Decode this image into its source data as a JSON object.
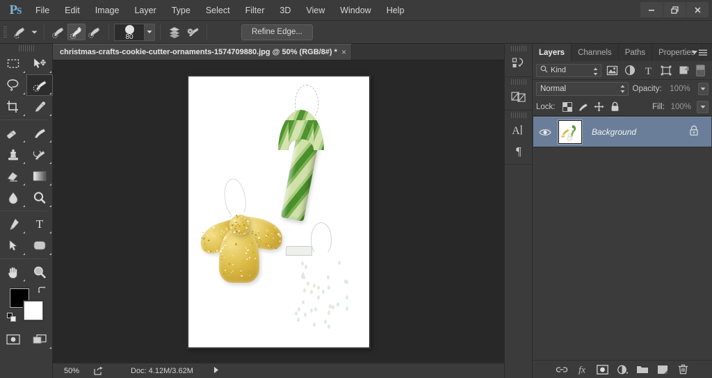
{
  "app": {
    "name": "Ps",
    "logo_text_p": "P",
    "logo_text_s": "s"
  },
  "menubar": {
    "items": [
      {
        "label": "File"
      },
      {
        "label": "Edit"
      },
      {
        "label": "Image"
      },
      {
        "label": "Layer"
      },
      {
        "label": "Type"
      },
      {
        "label": "Select"
      },
      {
        "label": "Filter"
      },
      {
        "label": "3D"
      },
      {
        "label": "View"
      },
      {
        "label": "Window"
      },
      {
        "label": "Help"
      }
    ],
    "window_controls": [
      {
        "name": "minimize",
        "glyph": "minimize-icon"
      },
      {
        "name": "restore",
        "glyph": "restore-icon"
      },
      {
        "name": "close",
        "glyph": "close-icon"
      }
    ]
  },
  "options_bar": {
    "tool_preset_icon": "quick-selection-tool-icon",
    "modes": [
      {
        "name": "new-selection",
        "active": false
      },
      {
        "name": "add-to-selection",
        "active": true
      },
      {
        "name": "subtract-from-selection",
        "active": false
      }
    ],
    "brush_size": "80",
    "sample_all_layers_icon": "sample-all-layers-icon",
    "auto_enhance_icon": "brush-settings-icon",
    "refine_edge_label": "Refine Edge..."
  },
  "toolbox": {
    "tools": [
      {
        "name": "rectangular-marquee-tool",
        "active": false
      },
      {
        "name": "move-tool",
        "active": false
      },
      {
        "name": "lasso-tool",
        "active": false
      },
      {
        "name": "quick-selection-tool",
        "active": true
      },
      {
        "name": "crop-tool",
        "active": false
      },
      {
        "name": "eyedropper-tool",
        "active": false
      },
      {
        "name": "spot-healing-brush-tool",
        "active": false
      },
      {
        "name": "brush-tool",
        "active": false
      },
      {
        "name": "clone-stamp-tool",
        "active": false
      },
      {
        "name": "history-brush-tool",
        "active": false
      },
      {
        "name": "eraser-tool",
        "active": false
      },
      {
        "name": "gradient-tool",
        "active": false
      },
      {
        "name": "blur-tool",
        "active": false
      },
      {
        "name": "dodge-tool",
        "active": false
      },
      {
        "name": "pen-tool",
        "active": false
      },
      {
        "name": "horizontal-type-tool",
        "active": false
      },
      {
        "name": "path-selection-tool",
        "active": false
      },
      {
        "name": "rounded-rectangle-tool",
        "active": false
      },
      {
        "name": "hand-tool",
        "active": false
      },
      {
        "name": "zoom-tool",
        "active": false
      }
    ],
    "foreground_color": "#000000",
    "background_color": "#ffffff",
    "quick_mask_icon": "quick-mask-icon",
    "screen_mode_icon": "screen-mode-icon"
  },
  "document": {
    "tab_title": "christmas-crafts-cookie-cutter-ornaments-1574709880.jpg @ 50% (RGB/8#) *",
    "close_glyph": "×",
    "canvas_background": "#ffffff",
    "ornaments": [
      {
        "name": "candy-cane-ornament",
        "colors": [
          "#4a8f2c",
          "#cfe0a8"
        ]
      },
      {
        "name": "angel-ornament",
        "colors": [
          "#d9b841",
          "#f5e08a"
        ]
      },
      {
        "name": "snowman-ornament",
        "colors": [
          "#ffffff",
          "#dfe8e0"
        ]
      }
    ]
  },
  "statusbar": {
    "zoom": "50%",
    "share_icon": "share-icon",
    "doc_info": "Doc: 4.12M/3.62M",
    "expand_icon": "play-arrow-icon"
  },
  "icon_rail": {
    "groups": [
      {
        "items": [
          {
            "name": "history-panel-icon"
          }
        ]
      },
      {
        "items": [
          {
            "name": "adjustments-panel-icon"
          }
        ]
      },
      {
        "items": [
          {
            "name": "character-panel-icon"
          },
          {
            "name": "paragraph-panel-icon"
          }
        ]
      }
    ]
  },
  "layers_panel": {
    "tabs": [
      {
        "label": "Layers",
        "active": true
      },
      {
        "label": "Channels",
        "active": false
      },
      {
        "label": "Paths",
        "active": false
      },
      {
        "label": "Properties",
        "active": false
      }
    ],
    "panel_menu_icon": "panel-menu-icon",
    "filter": {
      "search_icon": "search-icon",
      "kind_label": "Kind",
      "filter_icons": [
        {
          "name": "filter-pixel-layers-icon"
        },
        {
          "name": "filter-adjustment-layers-icon"
        },
        {
          "name": "filter-type-layers-icon"
        },
        {
          "name": "filter-shape-layers-icon"
        },
        {
          "name": "filter-smart-object-layers-icon"
        }
      ],
      "toggle_name": "filter-enable-toggle"
    },
    "blend_mode": "Normal",
    "opacity_label": "Opacity:",
    "opacity_value": "100%",
    "lock_label": "Lock:",
    "lock_icons": [
      {
        "name": "lock-transparent-pixels-icon"
      },
      {
        "name": "lock-image-pixels-icon"
      },
      {
        "name": "lock-position-icon"
      },
      {
        "name": "lock-all-icon"
      }
    ],
    "fill_label": "Fill:",
    "fill_value": "100%",
    "layers": [
      {
        "name": "Background",
        "visible": true,
        "locked": true,
        "selected": true,
        "eye_icon": "eye-icon",
        "lock_icon": "lock-icon",
        "highlight_color": "#6b7e99"
      }
    ],
    "footer_icons": [
      {
        "name": "link-layers-icon"
      },
      {
        "name": "layer-style-fx-icon"
      },
      {
        "name": "add-layer-mask-icon"
      },
      {
        "name": "new-adjustment-layer-icon"
      },
      {
        "name": "new-group-icon"
      },
      {
        "name": "new-layer-icon"
      },
      {
        "name": "delete-layer-icon"
      }
    ]
  }
}
